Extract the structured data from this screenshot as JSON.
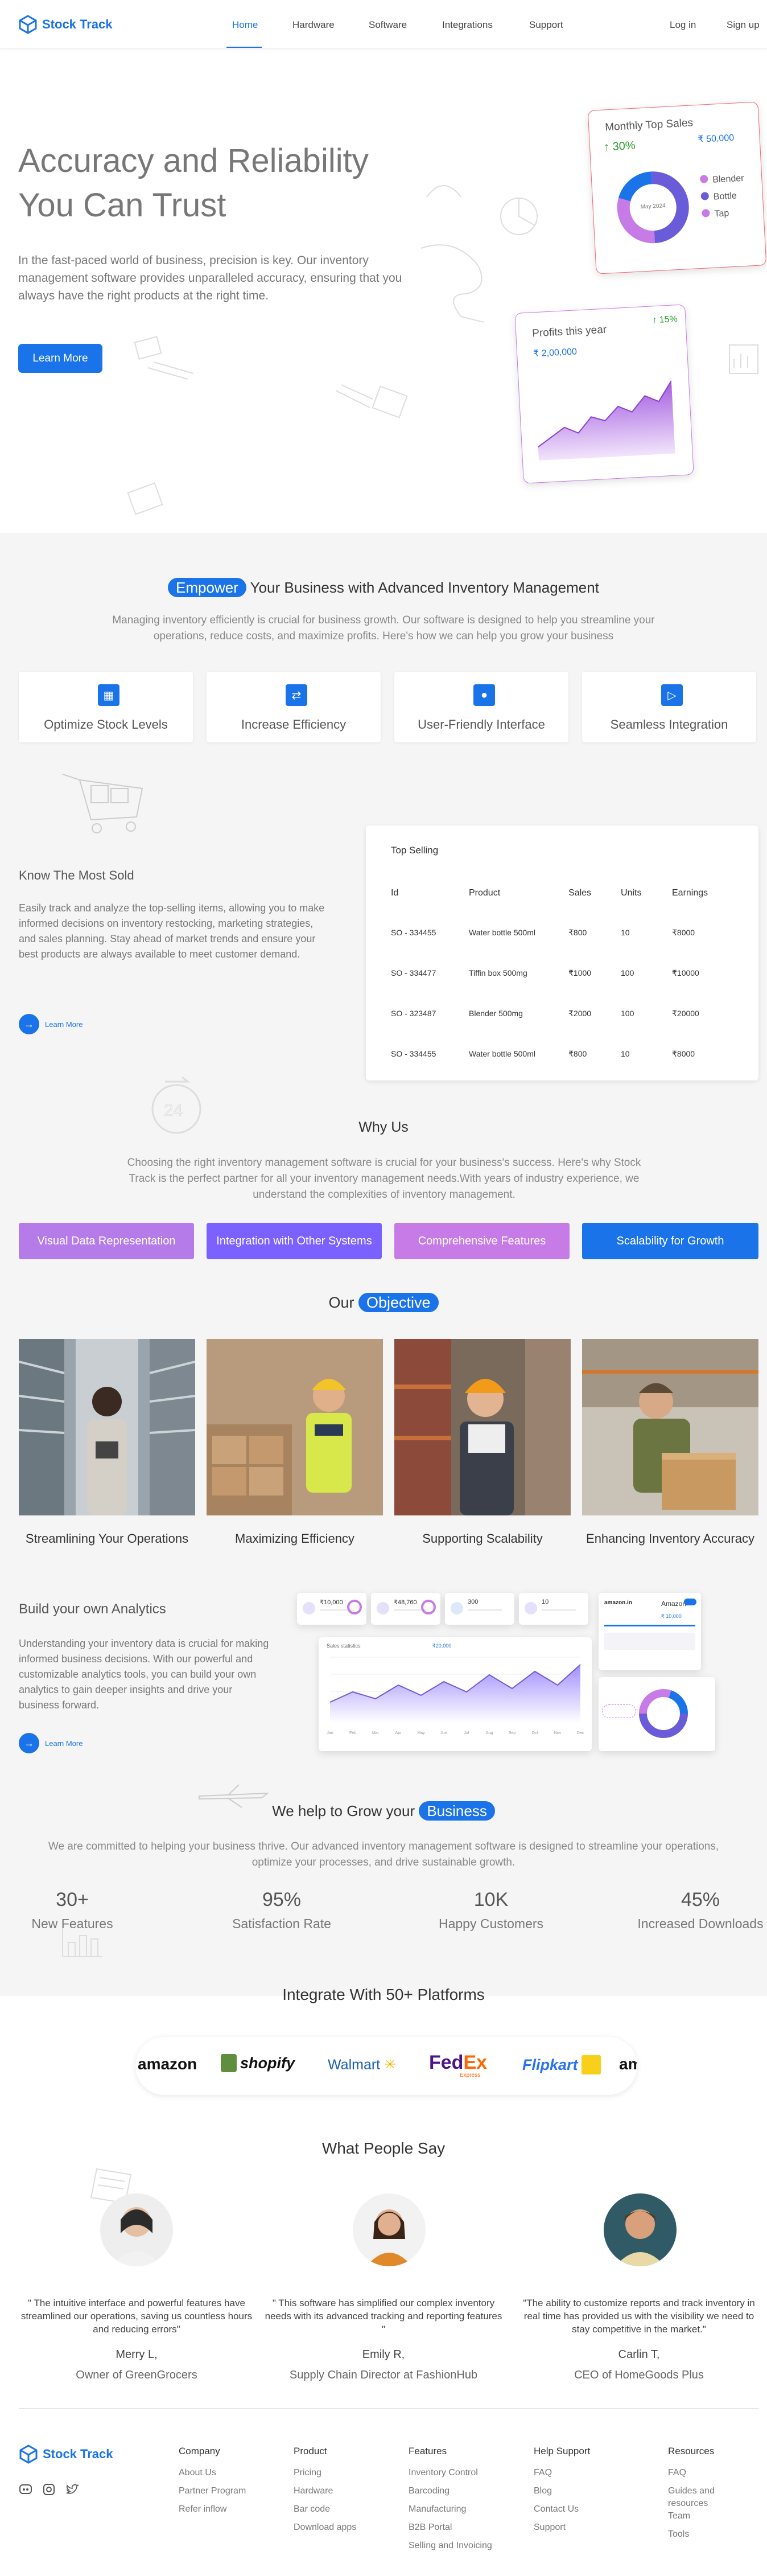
{
  "header": {
    "brand": "Stock Track",
    "nav": [
      "Home",
      "Hardware",
      "Software",
      "Integrations",
      "Support"
    ],
    "login": "Log in",
    "signup": "Sign up"
  },
  "hero": {
    "title_line1": "Accuracy and Reliability",
    "title_line2": "You Can Trust",
    "description": "In the fast-paced world of business, precision is key. Our inventory management software provides unparalleled accuracy, ensuring that you always have the right products at the right time.",
    "cta": "Learn More",
    "monthly_card": {
      "title": "Monthly Top Sales",
      "percent": "30%",
      "amount": "₹ 50,000",
      "center": "May 2024",
      "legend": [
        "Blender",
        "Bottle",
        "Tap"
      ],
      "slices": [
        50,
        30,
        20
      ],
      "colors": [
        "#6a5cd8",
        "#c77be6",
        "#1a73e8"
      ]
    },
    "profits_card": {
      "title": "Profits this year",
      "percent": "15%",
      "amount": "₹ 2,00,000",
      "trend": [
        0.15,
        0.25,
        0.35,
        0.28,
        0.45,
        0.4,
        0.55,
        0.48,
        0.65,
        0.58,
        0.8
      ]
    }
  },
  "empower": {
    "pill": "Empower",
    "title_rest": " Your Business with Advanced Inventory Management",
    "description": "Managing inventory efficiently is crucial for business growth. Our software is designed to help you streamline your operations, reduce costs, and maximize profits. Here's how we can help you grow your business",
    "features": [
      {
        "label": "Optimize Stock Levels",
        "icon": "grid-icon"
      },
      {
        "label": "Increase Efficiency",
        "icon": "shuffle-icon"
      },
      {
        "label": "User-Friendly Interface",
        "icon": "user-icon"
      },
      {
        "label": "Seamless Integration",
        "icon": "play-icon"
      }
    ]
  },
  "most_sold": {
    "title": "Know The Most Sold",
    "description": "Easily track and analyze the top-selling items, allowing you to make informed decisions on inventory restocking, marketing strategies, and sales planning. Stay ahead of market trends and ensure your best products are always available to meet customer demand.",
    "link": "Learn More",
    "table": {
      "title": "Top Selling",
      "headers": [
        "Id",
        "Product",
        "Sales",
        "Units",
        "Earnings"
      ],
      "rows": [
        [
          "SO - 334455",
          "Water bottle 500ml",
          "₹800",
          "10",
          "₹8000"
        ],
        [
          "SO - 334477",
          "Tiffin box 500mg",
          "₹1000",
          "100",
          "₹10000"
        ],
        [
          "SO - 323487",
          "Blender 500mg",
          "₹2000",
          "100",
          "₹20000"
        ],
        [
          "SO - 334455",
          "Water bottle 500ml",
          "₹800",
          "10",
          "₹8000"
        ]
      ]
    }
  },
  "why": {
    "title": "Why Us",
    "description": "Choosing the right inventory management software is crucial for your business's success. Here's why Stock Track is the perfect partner for all your inventory management needs.With years of industry experience, we understand the complexities of inventory management.",
    "buttons": [
      {
        "label": "Visual Data Representation",
        "color": "#b57be8"
      },
      {
        "label": "Integration with Other Systems",
        "color": "#7b61ff"
      },
      {
        "label": "Comprehensive Features",
        "color": "#c77be6"
      },
      {
        "label": "Scalability for Growth",
        "color": "#1a73e8"
      }
    ]
  },
  "objective": {
    "title_prefix": "Our ",
    "pill": "Objective",
    "items": [
      "Streamlining Your Operations",
      "Maximizing Efficiency",
      "Supporting Scalability",
      "Enhancing Inventory Accuracy"
    ]
  },
  "analytics": {
    "title": "Build your own Analytics",
    "description": "Understanding your inventory data is crucial for making informed business decisions. With our powerful and customizable analytics tools, you can build your own analytics to gain deeper insights and drive your business forward.",
    "link": "Learn More",
    "mini_stats": [
      "₹10,000",
      "₹48,760",
      "300",
      "10"
    ],
    "chart_title": "Sales statistics",
    "chart_amount": "₹20,000",
    "chart_trend": [
      0.3,
      0.45,
      0.35,
      0.55,
      0.4,
      0.6,
      0.45,
      0.7,
      0.5,
      0.75,
      0.55,
      0.85
    ],
    "x_ticks": [
      "Jan",
      "Feb",
      "Mar",
      "Apr",
      "May",
      "Jun",
      "Jul",
      "Aug",
      "Sep",
      "Oct",
      "Nov",
      "Dec"
    ],
    "amazon_card": {
      "logo": "amazon.in",
      "name": "Amazon",
      "amount": "₹ 10,000"
    }
  },
  "grow": {
    "title_prefix": "We help to Grow your ",
    "pill": "Business",
    "description": "We are committed to helping your business thrive. Our advanced inventory management software is designed to streamline your operations, optimize your processes, and drive sustainable growth.",
    "stats": [
      {
        "value": "30+",
        "label": "New Features"
      },
      {
        "value": "95%",
        "label": "Satisfaction Rate"
      },
      {
        "value": "10K",
        "label": "Happy Customers"
      },
      {
        "value": "45%",
        "label": "Increased Downloads"
      }
    ]
  },
  "integrate": {
    "title": "Integrate With 50+ Platforms",
    "logos": [
      "amazon",
      "shopify",
      "Walmart",
      "FedEx",
      "Flipkart",
      "am"
    ],
    "fedex_sub": "Express"
  },
  "testimonials": {
    "title": "What People Say",
    "items": [
      {
        "quote": "\" The intuitive interface and powerful features have streamlined our operations, saving us countless hours and reducing errors\"",
        "name": "Merry L,",
        "role": "Owner of GreenGrocers"
      },
      {
        "quote": "\" This software has simplified our complex inventory needs with its advanced tracking and reporting features \"",
        "name": "Emily R,",
        "role": "Supply Chain Director at FashionHub"
      },
      {
        "quote": "\"The ability to customize reports and track inventory in real time has provided us with the visibility we need to stay competitive in the market.\"",
        "name": "Carlin T,",
        "role": "CEO of HomeGoods Plus"
      }
    ]
  },
  "footer": {
    "brand": "Stock Track",
    "columns": [
      {
        "head": "Company",
        "links": [
          "About Us",
          "Partner Program",
          "Refer inflow"
        ]
      },
      {
        "head": "Product",
        "links": [
          "Pricing",
          "Hardware",
          "Bar code",
          "Download apps"
        ]
      },
      {
        "head": "Features",
        "links": [
          "Inventory Control",
          "Barcoding",
          "Manufacturing",
          "B2B Portal",
          "Selling and Invoicing"
        ]
      },
      {
        "head": "Help  Support",
        "links": [
          "FAQ",
          "Blog",
          "Contact Us",
          "Support"
        ]
      },
      {
        "head": "Resources",
        "links": [
          "FAQ",
          "Guides and resources",
          "Team",
          "Tools"
        ]
      }
    ]
  }
}
